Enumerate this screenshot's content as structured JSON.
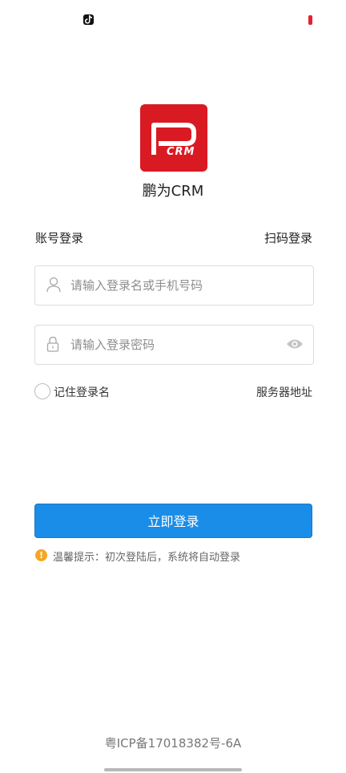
{
  "status_bar": {
    "left_icon": "tiktok-icon",
    "right_icon": "battery-icon",
    "battery_color": "#e8202f"
  },
  "app": {
    "logo_icon": "crm-logo-icon",
    "logo_text": "CRM",
    "logo_color": "#d91a22",
    "name": "鹏为CRM"
  },
  "tabs": {
    "account_login": "账号登录",
    "qr_login": "扫码登录"
  },
  "form": {
    "username": {
      "value": "",
      "placeholder": "请输入登录名或手机号码",
      "icon": "user-icon"
    },
    "password": {
      "value": "",
      "placeholder": "请输入登录密码",
      "icon": "lock-icon",
      "toggle_icon": "eye-icon"
    },
    "remember_label": "记住登录名",
    "remember_checked": false,
    "server_label": "服务器地址",
    "submit_label": "立即登录",
    "accent_color": "#1a8de8"
  },
  "tip": {
    "icon": "warning-icon",
    "icon_glyph": "!",
    "text": "温馨提示：初次登陆后，系统将自动登录"
  },
  "footer": {
    "icp": "粤ICP备17018382号-6A"
  }
}
